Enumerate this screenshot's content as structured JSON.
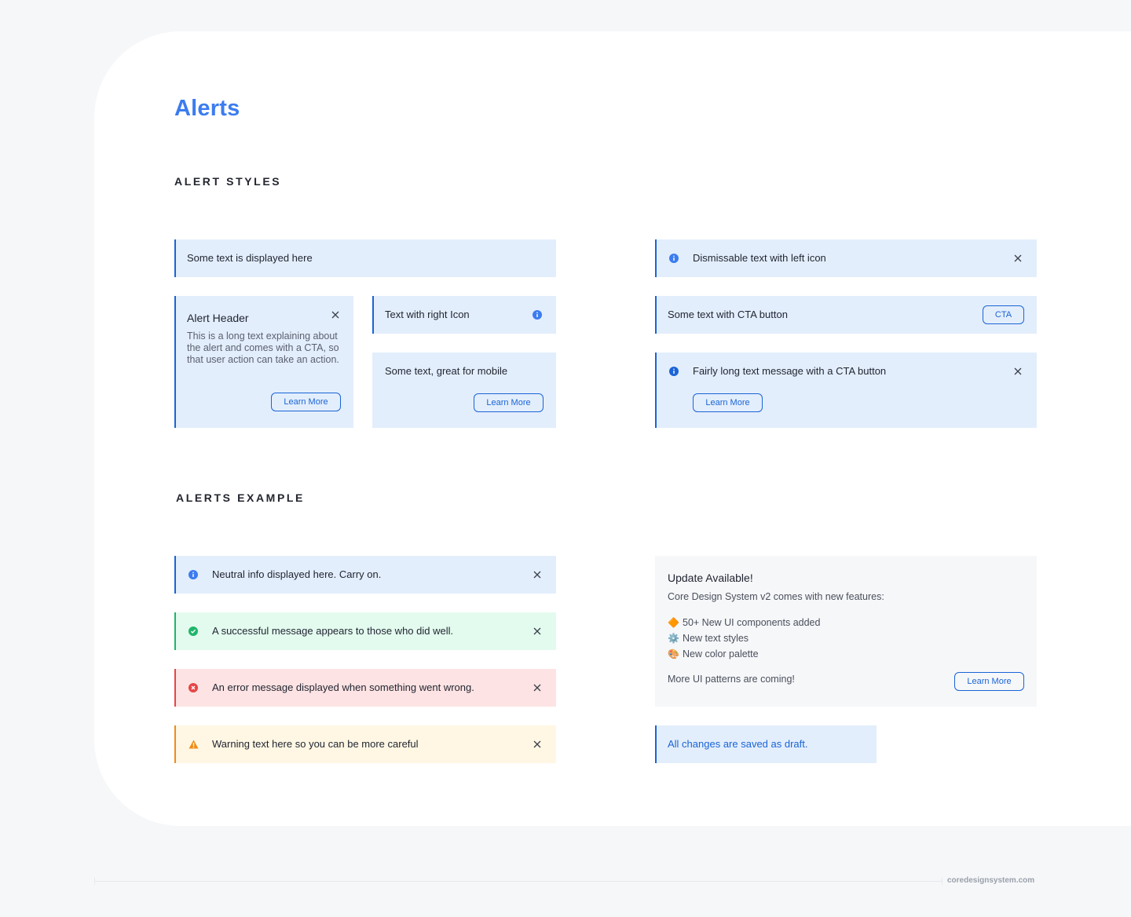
{
  "page": {
    "title": "Alerts",
    "section_styles": "ALERT STYLES",
    "section_example": "ALERTS EXAMPLE",
    "footer_domain": "coredesignsystem.com"
  },
  "colors": {
    "accent": "#1a64d6",
    "title_blue": "#3b7cf0",
    "info_bg": "#e3eefc",
    "success_bg": "#e3fbee",
    "success": "#1fb56a",
    "error_bg": "#fde3e3",
    "error": "#e64646",
    "warning_bg": "#fff7e3",
    "warning": "#f08c15"
  },
  "styles": {
    "simple": {
      "text": "Some text is displayed here"
    },
    "header_alert": {
      "title": "Alert Header",
      "body": "This is a long text explaining about the alert and comes with a CTA, so that user action can take an action.",
      "button": "Learn More"
    },
    "right_icon": {
      "text": "Text with right Icon",
      "icon": "info-icon"
    },
    "mobile": {
      "text": "Some text, great for mobile",
      "button": "Learn More"
    },
    "dismissable": {
      "text": "Dismissable text with left icon",
      "icon": "info-icon"
    },
    "cta": {
      "text": "Some text with CTA button",
      "button": "CTA"
    },
    "long_cta": {
      "text": "Fairly long text message with a CTA button",
      "button": "Learn More",
      "icon": "info-icon"
    }
  },
  "examples": {
    "info": {
      "text": "Neutral info displayed here. Carry on.",
      "icon": "info-icon"
    },
    "success": {
      "text": "A successful message appears to those who did well.",
      "icon": "check-circle-icon"
    },
    "error": {
      "text": "An error message displayed when something went wrong.",
      "icon": "error-circle-icon"
    },
    "warning": {
      "text": "Warning text here so you can be more careful",
      "icon": "warning-triangle-icon"
    },
    "update": {
      "title": "Update Available!",
      "subtitle": "Core Design System v2 comes with new features:",
      "items": [
        {
          "emoji": "🔶",
          "text": "50+ New UI components added"
        },
        {
          "emoji": "⚙️",
          "text": "New text styles"
        },
        {
          "emoji": "🎨",
          "text": "New color palette"
        }
      ],
      "footer": "More UI patterns are coming!",
      "button": "Learn More"
    },
    "draft": {
      "text": "All changes are saved as draft."
    }
  }
}
